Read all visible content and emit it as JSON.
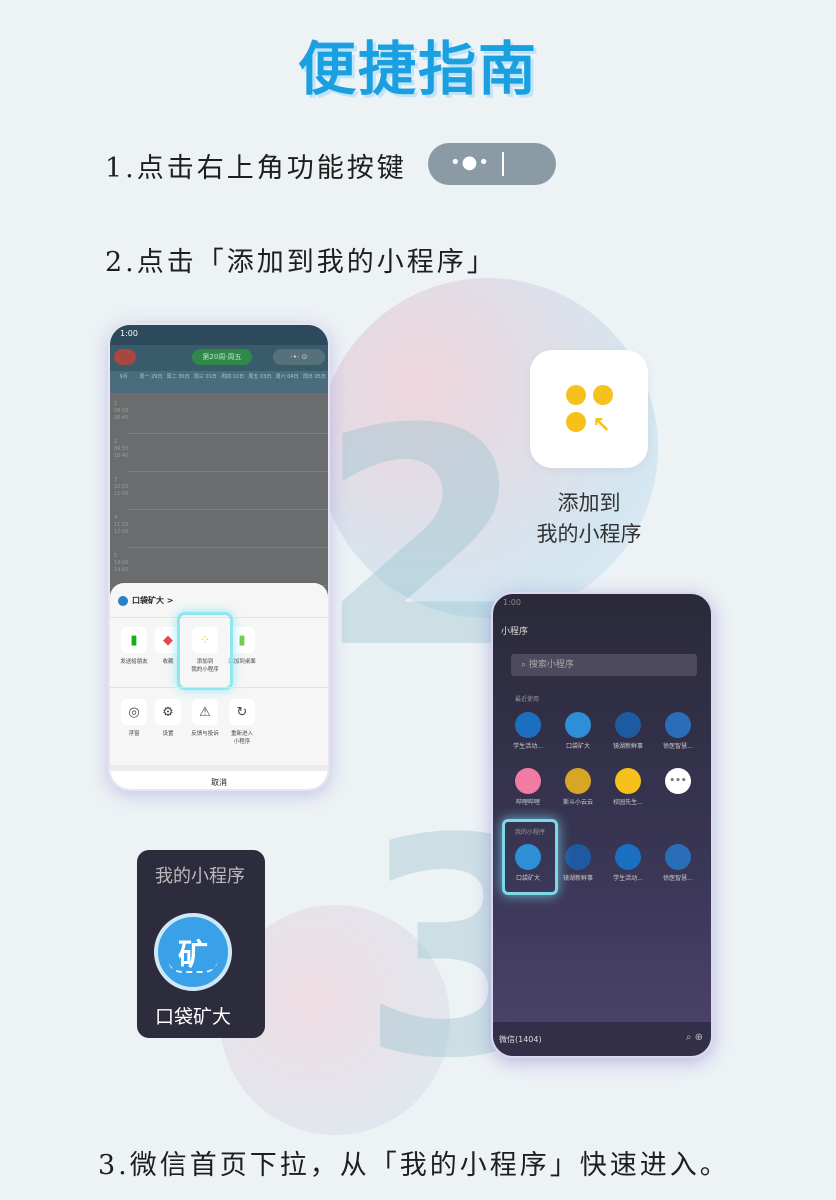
{
  "title": "便捷指南",
  "steps": {
    "step1": "1.点击右上角功能按键",
    "step2": "2.点击「添加到我的小程序」",
    "step3": "3.微信首页下拉，从「我的小程序」快速进入。"
  },
  "capsule": {
    "dots": "•●•"
  },
  "decor_numbers": {
    "two": "2",
    "three": "3"
  },
  "phone1": {
    "status_time": "1:00",
    "week_label": "第20周·周五",
    "capsule_label": "·•·  ⊙",
    "days": [
      "9月",
      "周一 29日",
      "周二 30日",
      "周三 01日",
      "周四 02日",
      "周五 03日",
      "周六 04日",
      "周日 05日"
    ],
    "slots": [
      {
        "n": "1",
        "t1": "08:00",
        "t2": "08:45"
      },
      {
        "n": "2",
        "t1": "09:55",
        "t2": "10:40"
      },
      {
        "n": "3",
        "t1": "10:15",
        "t2": "11:00"
      },
      {
        "n": "4",
        "t1": "11:10",
        "t2": "12:00"
      },
      {
        "n": "5",
        "t1": "14:00",
        "t2": "14:50"
      }
    ],
    "sheet_title": "口袋矿大 >",
    "actions_row1": [
      "发送给朋友",
      "收藏",
      "添加到\n我的小程序",
      "添加到桌面"
    ],
    "actions_row2": [
      "浮窗",
      "设置",
      "反馈与投诉",
      "重新进入\n小程序"
    ],
    "cancel": "取消"
  },
  "add_card": {
    "label_line1": "添加到",
    "label_line2": "我的小程序"
  },
  "phone2": {
    "status_time": "1:00",
    "title": "小程序",
    "search_placeholder": "搜索小程序",
    "recent_label": "最近使用",
    "my_label": "我的小程序",
    "recent_row1": [
      "学生活动...",
      "口袋矿大",
      "镜湖新鲜事",
      "徐医智慧..."
    ],
    "recent_row2": [
      "哔哩哔哩",
      "斯斗小云云",
      "校园先生...",
      ""
    ],
    "my_row": [
      "口袋矿大",
      "镜湖新鲜事",
      "学生活动...",
      "徐医智慧..."
    ],
    "bottom_label": "微信(1404)"
  },
  "my_card": {
    "title": "我的小程序",
    "logo_text": "矿",
    "name": "口袋矿大"
  }
}
